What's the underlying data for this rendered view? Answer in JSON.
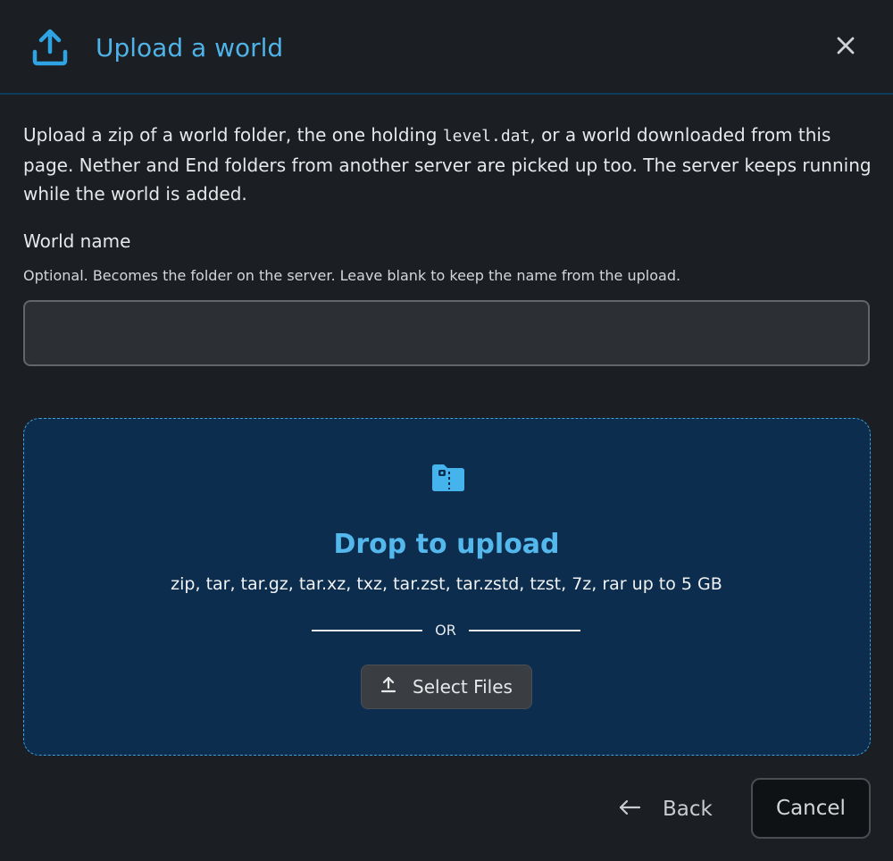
{
  "dialog": {
    "title": "Upload a world",
    "title_icon": "upload-arrow-icon",
    "close_icon": "close-icon"
  },
  "intro": {
    "text_before": "Upload a zip of a world folder, the one holding ",
    "code": "level.dat",
    "text_after": ", or a world downloaded from this page. Nether and End folders from another server are picked up too. The server keeps running while the world is added."
  },
  "world_name": {
    "label": "World name",
    "help": "Optional. Becomes the folder on the server. Leave blank to keep the name from the upload.",
    "value": "",
    "placeholder": ""
  },
  "dropzone": {
    "icon": "file-zip-icon",
    "title": "Drop to upload",
    "formats": "zip, tar, tar.gz, tar.xz, txz, tar.zst, tar.zstd, tzst, 7z, rar up to 5 GB",
    "or_label": "OR",
    "select_label": "Select Files",
    "select_icon": "upload-icon"
  },
  "footer": {
    "back_label": "Back",
    "back_icon": "arrow-left-icon",
    "cancel_label": "Cancel"
  },
  "colors": {
    "background": "#1b1e22",
    "accent": "#4fb3e8",
    "dropzone_bg": "#0c2d4d",
    "dropzone_border": "#3aa3dd"
  }
}
